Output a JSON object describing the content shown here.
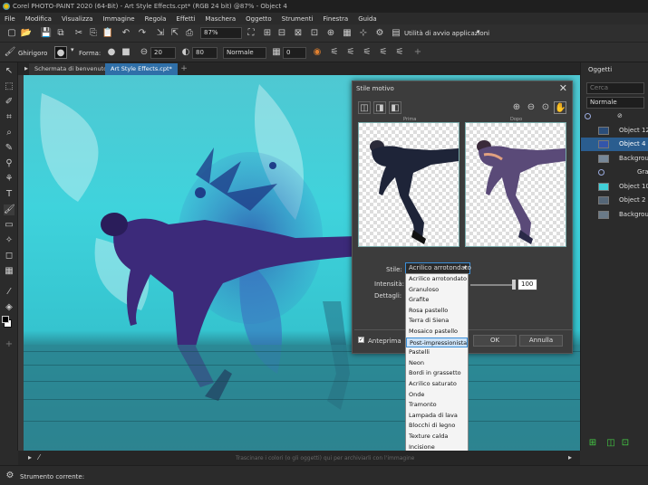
{
  "window": {
    "title": "Corel PHOTO-PAINT 2020 (64-Bit) - Art Style Effects.cpt* (RGB 24 bit) @87% - Object 4"
  },
  "menu": [
    "File",
    "Modifica",
    "Visualizza",
    "Immagine",
    "Regola",
    "Effetti",
    "Maschera",
    "Oggetto",
    "Strumenti",
    "Finestra",
    "Guida"
  ],
  "toolbar": {
    "zoom": "87%",
    "launcher": "Utilità di avvio applicazioni"
  },
  "property_bar": {
    "tool_label": "Ghirigoro",
    "shape_label": "Forma:",
    "size": "20",
    "transparency": "80",
    "blend_mode": "Normale",
    "opacity": "0"
  },
  "doc_tabs": [
    {
      "label": "Schermata di benvenuto"
    },
    {
      "label": "Art Style Effects.cpt*"
    }
  ],
  "hint_text": "Trascinare i colori (o gli oggetti) qui per archiviarli con l'immagine",
  "dialog": {
    "title": "Stile motivo",
    "before_label": "Prima",
    "after_label": "Dopo",
    "style_label": "Stile:",
    "style_value": "Acrilico arrotondato",
    "intensity_label": "Intensità:",
    "intensity_value": "100",
    "details_label": "Dettagli:",
    "preview_label": "Anteprima",
    "ok": "OK",
    "cancel": "Annulla"
  },
  "style_options": [
    "Acrilico arrotondato",
    "Granuloso",
    "Grafite",
    "Rosa pastello",
    "Terra di Siena",
    "Mosaico pastello",
    "Post-impressionista",
    "Pastelli",
    "Neon",
    "Bordi in grassetto",
    "Acrilico saturato",
    "Onde",
    "Tramonto",
    "Lampada di lava",
    "Blocchi di legno",
    "Texture calda",
    "Incisione"
  ],
  "selected_style": "Post-impressionista",
  "objects_panel": {
    "title": "Oggetti",
    "search_placeholder": "Cerca",
    "blend_mode": "Normale",
    "rows": [
      {
        "label": ""
      },
      {
        "label": "Object 12"
      },
      {
        "label": "Object 4"
      },
      {
        "label": "Background"
      },
      {
        "label": "Grad"
      },
      {
        "label": "Object 10"
      },
      {
        "label": "Object 2"
      },
      {
        "label": "Background"
      }
    ]
  },
  "status": {
    "current_tool": "Strumento corrente:"
  },
  "colors": {
    "accent": "#3b8fd9",
    "canvas_cyan": "#40cfd8",
    "selected_row": "#2a5d8f"
  }
}
